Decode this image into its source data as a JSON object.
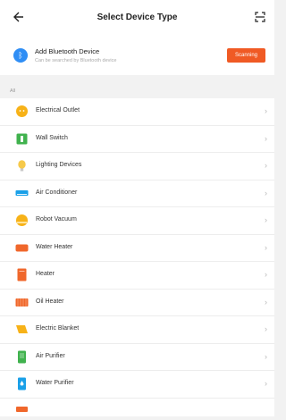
{
  "header": {
    "title": "Select Device Type",
    "back_icon": "back-arrow-icon",
    "scan_icon": "scan-icon"
  },
  "bluetooth": {
    "title": "Add Bluetooth Device",
    "subtitle": "Can be searched by Bluetooth device",
    "button_label": "Scanning",
    "accent": "#f05a24",
    "icon": "bluetooth-icon",
    "icon_color": "#2f8ef5"
  },
  "section": {
    "label": "All"
  },
  "devices": [
    {
      "label": "Electrical Outlet",
      "icon": "outlet-icon",
      "color": "#f7b218"
    },
    {
      "label": "Wall Switch",
      "icon": "switch-icon",
      "color": "#40b24e"
    },
    {
      "label": "Lighting Devices",
      "icon": "bulb-icon",
      "color": "#f6c94a"
    },
    {
      "label": "Air Conditioner",
      "icon": "air-conditioner-icon",
      "color": "#1aa0e8"
    },
    {
      "label": "Robot Vacuum",
      "icon": "robot-vacuum-icon",
      "color": "#f7b218"
    },
    {
      "label": "Water Heater",
      "icon": "water-heater-icon",
      "color": "#f0672b"
    },
    {
      "label": "Heater",
      "icon": "heater-icon",
      "color": "#f0672b"
    },
    {
      "label": "Oil Heater",
      "icon": "oil-heater-icon",
      "color": "#f0672b"
    },
    {
      "label": "Electric Blanket",
      "icon": "blanket-icon",
      "color": "#f7b218"
    },
    {
      "label": "Air Purifier",
      "icon": "air-purifier-icon",
      "color": "#40b24e"
    },
    {
      "label": "Water Purifier",
      "icon": "water-purifier-icon",
      "color": "#1aa0e8"
    }
  ]
}
